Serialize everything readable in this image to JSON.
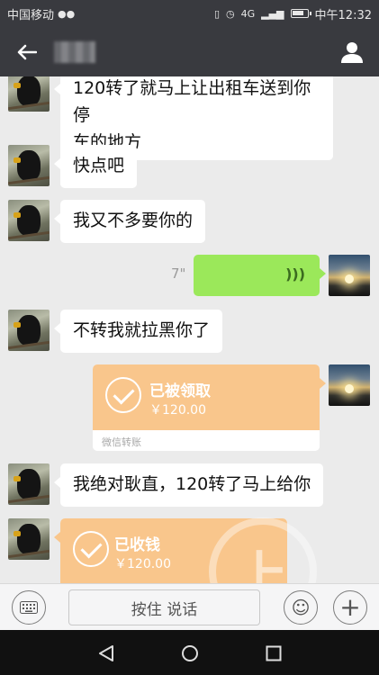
{
  "status_bar": {
    "carrier": "中国移动",
    "network": "4G",
    "time": "中午12:32",
    "battery_level": 0.8
  },
  "title_bar": {
    "contact_name_blurred": true,
    "icons": [
      "back-arrow-icon",
      "profile-icon"
    ]
  },
  "messages": [
    {
      "side": "left",
      "type": "text",
      "avatar": "bird",
      "lines": [
        "120转了就马上让出租车送到你停",
        "车的地方"
      ]
    },
    {
      "side": "left",
      "type": "text",
      "avatar": "bird",
      "lines": [
        "快点吧"
      ]
    },
    {
      "side": "left",
      "type": "text",
      "avatar": "bird",
      "lines": [
        "我又不多要你的"
      ]
    },
    {
      "side": "right",
      "type": "voice",
      "avatar": "sunset",
      "duration": "7\""
    },
    {
      "side": "left",
      "type": "text",
      "avatar": "bird",
      "lines": [
        "不转我就拉黑你了"
      ]
    },
    {
      "side": "right",
      "type": "transfer",
      "avatar": "sunset",
      "status": "已被领取",
      "amount": "￥120.00",
      "footer": "微信转账"
    },
    {
      "side": "left",
      "type": "text",
      "avatar": "bird",
      "lines": [
        "我绝对耿直，120转了马上给你"
      ]
    },
    {
      "side": "left",
      "type": "transfer",
      "avatar": "bird",
      "status": "已收钱",
      "amount": "￥120.00"
    }
  ],
  "input_bar": {
    "hold_to_talk": "按住 说话",
    "icons": [
      "keyboard-icon",
      "emoji-icon",
      "plus-icon"
    ]
  },
  "nav_bar": {
    "icons": [
      "nav-back-icon",
      "nav-home-icon",
      "nav-recent-icon"
    ]
  },
  "colors": {
    "header_bg": "#393a3f",
    "chat_bg": "#ebebeb",
    "voice_bubble": "#9be85a",
    "transfer_orange": "#f9c68c"
  }
}
